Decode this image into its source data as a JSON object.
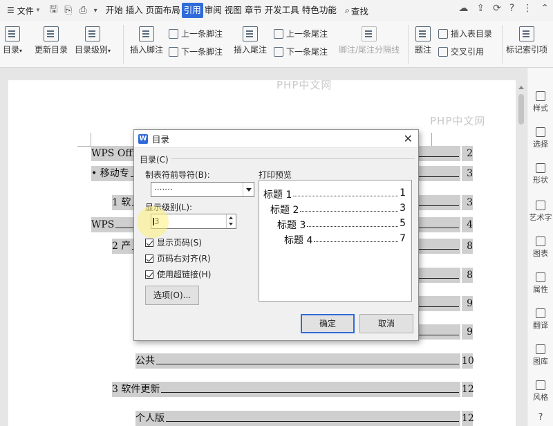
{
  "menubar": {
    "file_label": "文件",
    "tabs": [
      "开始",
      "插入",
      "页面布局",
      "引用",
      "审阅",
      "视图",
      "章节",
      "开发工具",
      "特色功能"
    ],
    "active_tab": "引用",
    "search_label": "查找"
  },
  "ribbon": {
    "toc": "目录",
    "update_toc": "更新目录",
    "toc_level": "目录级别",
    "insert_footnote": "插入脚注",
    "prev_footnote": "上一条脚注",
    "next_footnote": "下一条脚注",
    "insert_endnote": "插入尾注",
    "prev_endnote": "上一条尾注",
    "next_endnote": "下一条尾注",
    "separator": "脚注/尾注分隔线",
    "caption": "题注",
    "insert_table_toc": "插入表目录",
    "cross_ref": "交叉引用",
    "mark_index": "标记索引项"
  },
  "sidebar": {
    "items": [
      "样式",
      "选择",
      "形状",
      "艺术字",
      "图表",
      "属性",
      "翻译",
      "图库",
      "风格"
    ]
  },
  "document": {
    "lines": [
      {
        "text": "WPS Offi",
        "page": "2"
      },
      {
        "text": "• 移动专",
        "page": "3"
      },
      {
        "text": "1 软",
        "page": "3"
      },
      {
        "text": "WPS",
        "page": "4"
      },
      {
        "text": "2 产",
        "page": "8"
      },
      {
        "text": "",
        "page": "8"
      },
      {
        "text": "",
        "page": "9"
      },
      {
        "text": "",
        "page": "9"
      },
      {
        "text": "公共",
        "page": "10"
      },
      {
        "text": "3 软件更新",
        "page": "12"
      },
      {
        "text": "个人版",
        "page": "12"
      }
    ]
  },
  "watermark": "PHP中文网",
  "dialog": {
    "title": "目录",
    "group": "目录(C)",
    "leader_label": "制表符前导符(B):",
    "leader_value": "·······",
    "level_label": "显示级别(L):",
    "level_value": "3",
    "show_page": "显示页码(S)",
    "align_right": "页码右对齐(R)",
    "use_link": "使用超链接(H)",
    "options": "选项(O)...",
    "preview_label": "打印预览",
    "preview": [
      {
        "text": "标题 1",
        "page": "1"
      },
      {
        "text": "标题 2",
        "page": "3"
      },
      {
        "text": "标题 3",
        "page": "5"
      },
      {
        "text": "标题 4",
        "page": "7"
      }
    ],
    "ok": "确定",
    "cancel": "取消"
  }
}
